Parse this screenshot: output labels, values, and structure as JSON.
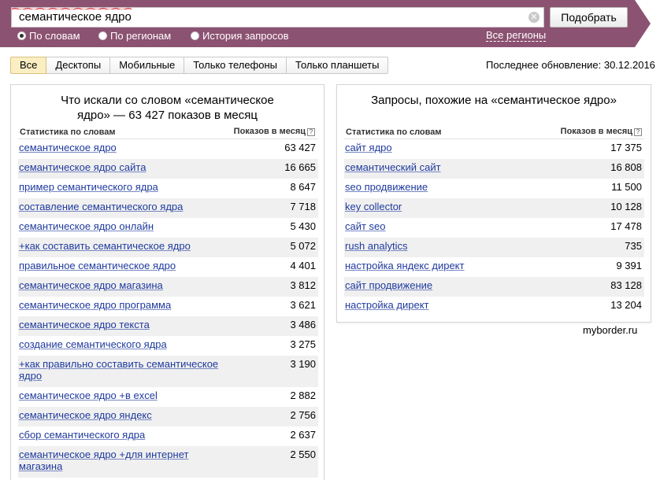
{
  "search": {
    "query": "семантическое ядро",
    "clear_symbol": "✕",
    "submit_label": "Подобрать"
  },
  "modes": [
    {
      "label": "По словам",
      "selected": true
    },
    {
      "label": "По регионам",
      "selected": false
    },
    {
      "label": "История запросов",
      "selected": false
    }
  ],
  "regions_link": "Все регионы",
  "tabs": [
    {
      "label": "Все",
      "active": true
    },
    {
      "label": "Десктопы",
      "active": false
    },
    {
      "label": "Мобильные",
      "active": false
    },
    {
      "label": "Только телефоны",
      "active": false
    },
    {
      "label": "Только планшеты",
      "active": false
    }
  ],
  "last_update": "Последнее обновление: 30.12.2016",
  "colors": {
    "band": "#8c5271",
    "link": "#1f3a9e",
    "active_tab": "#fbeec2",
    "alt_row": "#f0f0f0"
  },
  "left_panel": {
    "title_line1": "Что искали со словом «семантическое",
    "title_line2": "ядро» — 63 427 показов в месяц",
    "col_query": "Статистика по словам",
    "col_count": "Показов в месяц",
    "help": "?",
    "rows": [
      {
        "q": "семантическое ядро",
        "n": "63 427"
      },
      {
        "q": "семантическое ядро сайта",
        "n": "16 665"
      },
      {
        "q": "пример семантического ядра",
        "n": "8 647"
      },
      {
        "q": "составление семантического ядра",
        "n": "7 718"
      },
      {
        "q": "семантическое ядро онлайн",
        "n": "5 430"
      },
      {
        "q": "+как составить семантическое ядро",
        "n": "5 072"
      },
      {
        "q": "правильное семантическое ядро",
        "n": "4 401"
      },
      {
        "q": "семантическое ядро магазина",
        "n": "3 812"
      },
      {
        "q": "семантическое ядро программа",
        "n": "3 621"
      },
      {
        "q": "семантическое ядро текста",
        "n": "3 486"
      },
      {
        "q": "создание семантического ядра",
        "n": "3 275"
      },
      {
        "q": "+как правильно составить семантическое ядро",
        "n": "3 190"
      },
      {
        "q": "семантическое ядро +в excel",
        "n": "2 882"
      },
      {
        "q": "семантическое ядро яндекс",
        "n": "2 756"
      },
      {
        "q": "сбор семантического ядра",
        "n": "2 637"
      },
      {
        "q": "семантическое ядро +для интернет магазина",
        "n": "2 550"
      }
    ]
  },
  "right_panel": {
    "title": "Запросы, похожие на «семантическое ядро»",
    "col_query": "Статистика по словам",
    "col_count": "Показов в месяц",
    "help": "?",
    "rows": [
      {
        "q": "сайт ядро",
        "n": "17 375"
      },
      {
        "q": "семантический сайт",
        "n": "16 808"
      },
      {
        "q": "seo продвижение",
        "n": "11 500"
      },
      {
        "q": "key collector",
        "n": "10 128"
      },
      {
        "q": "сайт seo",
        "n": "17 478"
      },
      {
        "q": "rush analytics",
        "n": "735"
      },
      {
        "q": "настройка яндекс директ",
        "n": "9 391"
      },
      {
        "q": "сайт продвижение",
        "n": "83 128"
      },
      {
        "q": "настройка директ",
        "n": "13 204"
      }
    ]
  },
  "watermark": "myborder.ru"
}
